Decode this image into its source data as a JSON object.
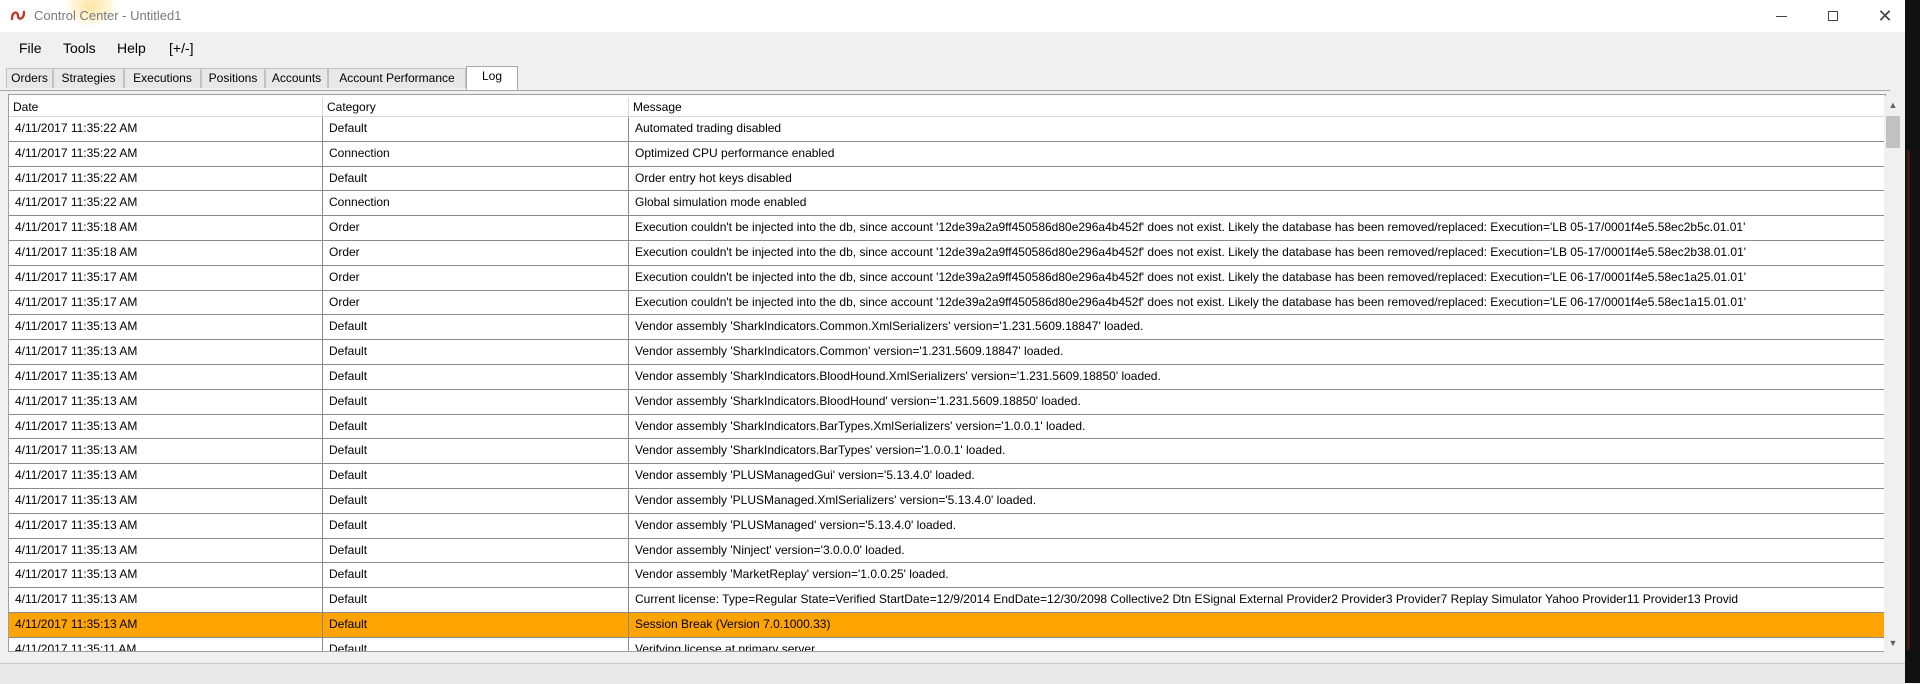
{
  "window": {
    "title": "Control Center - Untitled1",
    "controls": {
      "minimize": "minimize",
      "maximize": "maximize",
      "close": "✕"
    }
  },
  "menu": [
    "File",
    "Tools",
    "Help",
    "[+/-]"
  ],
  "tabs": [
    {
      "label": "Orders"
    },
    {
      "label": "Strategies"
    },
    {
      "label": "Executions"
    },
    {
      "label": "Positions"
    },
    {
      "label": "Accounts"
    },
    {
      "label": "Account Performance"
    },
    {
      "label": "Log",
      "active": true
    }
  ],
  "grid": {
    "headers": {
      "date": "Date",
      "category": "Category",
      "message": "Message"
    },
    "rows": [
      {
        "date": "4/11/2017 11:35:22 AM",
        "category": "Default",
        "message": "Automated trading disabled"
      },
      {
        "date": "4/11/2017 11:35:22 AM",
        "category": "Connection",
        "message": "Optimized CPU performance enabled"
      },
      {
        "date": "4/11/2017 11:35:22 AM",
        "category": "Default",
        "message": "Order entry hot keys disabled"
      },
      {
        "date": "4/11/2017 11:35:22 AM",
        "category": "Connection",
        "message": "Global simulation mode enabled"
      },
      {
        "date": "4/11/2017 11:35:18 AM",
        "category": "Order",
        "message": "Execution couldn't be injected into the db, since account '12de39a2a9ff450586d80e296a4b452f' does not exist. Likely the database has been removed/replaced: Execution='LB 05-17/0001f4e5.58ec2b5c.01.01'"
      },
      {
        "date": "4/11/2017 11:35:18 AM",
        "category": "Order",
        "message": "Execution couldn't be injected into the db, since account '12de39a2a9ff450586d80e296a4b452f' does not exist. Likely the database has been removed/replaced: Execution='LB 05-17/0001f4e5.58ec2b38.01.01'"
      },
      {
        "date": "4/11/2017 11:35:17 AM",
        "category": "Order",
        "message": "Execution couldn't be injected into the db, since account '12de39a2a9ff450586d80e296a4b452f' does not exist. Likely the database has been removed/replaced: Execution='LE 06-17/0001f4e5.58ec1a25.01.01'"
      },
      {
        "date": "4/11/2017 11:35:17 AM",
        "category": "Order",
        "message": "Execution couldn't be injected into the db, since account '12de39a2a9ff450586d80e296a4b452f' does not exist. Likely the database has been removed/replaced: Execution='LE 06-17/0001f4e5.58ec1a15.01.01'"
      },
      {
        "date": "4/11/2017 11:35:13 AM",
        "category": "Default",
        "message": "Vendor assembly 'SharkIndicators.Common.XmlSerializers' version='1.231.5609.18847' loaded."
      },
      {
        "date": "4/11/2017 11:35:13 AM",
        "category": "Default",
        "message": "Vendor assembly 'SharkIndicators.Common' version='1.231.5609.18847' loaded."
      },
      {
        "date": "4/11/2017 11:35:13 AM",
        "category": "Default",
        "message": "Vendor assembly 'SharkIndicators.BloodHound.XmlSerializers' version='1.231.5609.18850' loaded."
      },
      {
        "date": "4/11/2017 11:35:13 AM",
        "category": "Default",
        "message": "Vendor assembly 'SharkIndicators.BloodHound' version='1.231.5609.18850' loaded."
      },
      {
        "date": "4/11/2017 11:35:13 AM",
        "category": "Default",
        "message": "Vendor assembly 'SharkIndicators.BarTypes.XmlSerializers' version='1.0.0.1' loaded."
      },
      {
        "date": "4/11/2017 11:35:13 AM",
        "category": "Default",
        "message": "Vendor assembly 'SharkIndicators.BarTypes' version='1.0.0.1' loaded."
      },
      {
        "date": "4/11/2017 11:35:13 AM",
        "category": "Default",
        "message": "Vendor assembly 'PLUSManagedGui' version='5.13.4.0' loaded."
      },
      {
        "date": "4/11/2017 11:35:13 AM",
        "category": "Default",
        "message": "Vendor assembly 'PLUSManaged.XmlSerializers' version='5.13.4.0' loaded."
      },
      {
        "date": "4/11/2017 11:35:13 AM",
        "category": "Default",
        "message": "Vendor assembly 'PLUSManaged' version='5.13.4.0' loaded."
      },
      {
        "date": "4/11/2017 11:35:13 AM",
        "category": "Default",
        "message": "Vendor assembly 'Ninject' version='3.0.0.0' loaded."
      },
      {
        "date": "4/11/2017 11:35:13 AM",
        "category": "Default",
        "message": "Vendor assembly 'MarketReplay' version='1.0.0.25' loaded."
      },
      {
        "date": "4/11/2017 11:35:13 AM",
        "category": "Default",
        "message": "Current license: Type=Regular State=Verified StartDate=12/9/2014 EndDate=12/30/2098 Collective2 Dtn ESignal External Provider2 Provider3 Provider7 Replay Simulator Yahoo Provider11 Provider13 Provid"
      },
      {
        "date": "4/11/2017 11:35:13 AM",
        "category": "Default",
        "message": "Session Break (Version 7.0.1000.33)",
        "highlighted": true
      },
      {
        "date": "4/11/2017 11:35:11 AM",
        "category": "Default",
        "message": "Verifying license at primary server"
      }
    ]
  },
  "colors": {
    "highlight_row": "#ffa400",
    "app_icon": "#c0392b"
  },
  "icons": {
    "app": "app-logo-icon",
    "scroll_up": "scroll-up-arrow-icon",
    "scroll_down": "scroll-down-arrow-icon"
  }
}
